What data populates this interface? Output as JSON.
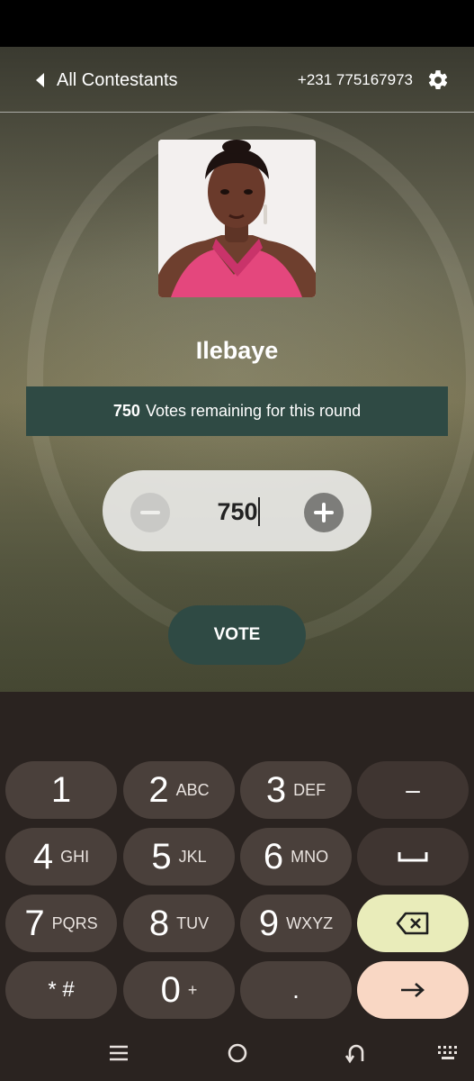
{
  "header": {
    "back_label": "All Contestants",
    "phone": "+231 775167973",
    "back_icon": "chevron-left-icon",
    "settings_icon": "gear-icon"
  },
  "contestant": {
    "name": "Ilebaye",
    "votes_remaining": "750",
    "votes_remaining_text": "Votes remaining for this round"
  },
  "vote_input": {
    "value": "750"
  },
  "vote_button": "VOTE",
  "keypad": {
    "keys": [
      {
        "num": "1",
        "sub": ""
      },
      {
        "num": "2",
        "sub": "ABC"
      },
      {
        "num": "3",
        "sub": "DEF"
      },
      {
        "num": "4",
        "sub": "GHI"
      },
      {
        "num": "5",
        "sub": "JKL"
      },
      {
        "num": "6",
        "sub": "MNO"
      },
      {
        "num": "7",
        "sub": "PQRS"
      },
      {
        "num": "8",
        "sub": "TUV"
      },
      {
        "num": "9",
        "sub": "WXYZ"
      },
      {
        "num": "0",
        "sub": "+"
      }
    ],
    "symbols_key": "* #",
    "dash_key": "–",
    "dot_key": ".",
    "icons": {
      "space": "space-icon",
      "backspace": "backspace-icon",
      "enter": "arrow-right-icon"
    }
  },
  "colors": {
    "accent": "#2f4a44",
    "keyboard_bg": "#2a2320",
    "key_bg": "#4a403b",
    "backspace_bg": "#e9ecba",
    "enter_bg": "#f9d7c4"
  }
}
